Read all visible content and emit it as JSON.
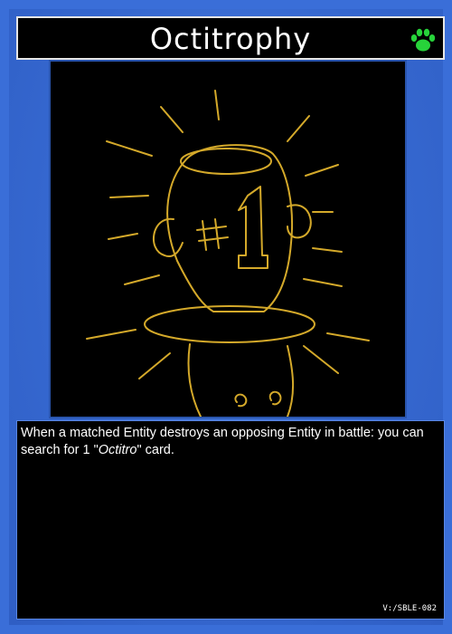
{
  "card": {
    "name": "Octitrophy",
    "attribute_icon": "paw-print-icon",
    "attribute_color": "#27d33a",
    "artwork": "octopus-trophy-illustration",
    "art_line_color": "#d4a92a",
    "effect_part1": "When a matched Entity destroys an opposing Entity in battle: you can search for 1 \"",
    "effect_archetype": "Octitro",
    "effect_part2": "\" card.",
    "set_code": "V:/SBLE-082",
    "trophy_label": "#1"
  }
}
